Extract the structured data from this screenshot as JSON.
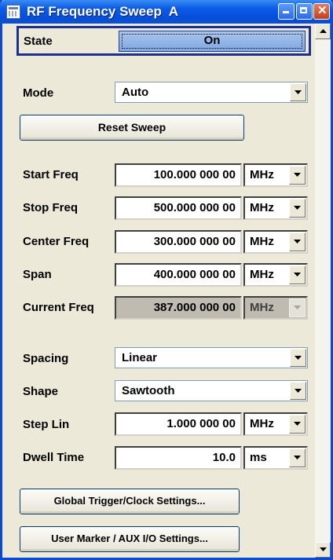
{
  "window": {
    "title": "RF Frequency Sweep  A"
  },
  "state": {
    "label": "State",
    "value": "On"
  },
  "mode": {
    "label": "Mode",
    "value": "Auto"
  },
  "reset_button": "Reset Sweep",
  "frequencies": [
    {
      "label": "Start Freq",
      "value": "100.000 000 00",
      "unit": "MHz",
      "readonly": false
    },
    {
      "label": "Stop Freq",
      "value": "500.000 000 00",
      "unit": "MHz",
      "readonly": false
    },
    {
      "label": "Center Freq",
      "value": "300.000 000 00",
      "unit": "MHz",
      "readonly": false
    },
    {
      "label": "Span",
      "value": "400.000 000 00",
      "unit": "MHz",
      "readonly": false
    },
    {
      "label": "Current Freq",
      "value": "387.000 000 00",
      "unit": "MHz",
      "readonly": true
    }
  ],
  "spacing": {
    "label": "Spacing",
    "value": "Linear"
  },
  "shape": {
    "label": "Shape",
    "value": "Sawtooth"
  },
  "step_lin": {
    "label": "Step Lin",
    "value": "1.000 000 00",
    "unit": "MHz"
  },
  "dwell_time": {
    "label": "Dwell Time",
    "value": "10.0",
    "unit": "ms"
  },
  "global_trigger_button": "Global Trigger/Clock Settings...",
  "user_marker_button": "User Marker / AUX I/O Settings..."
}
